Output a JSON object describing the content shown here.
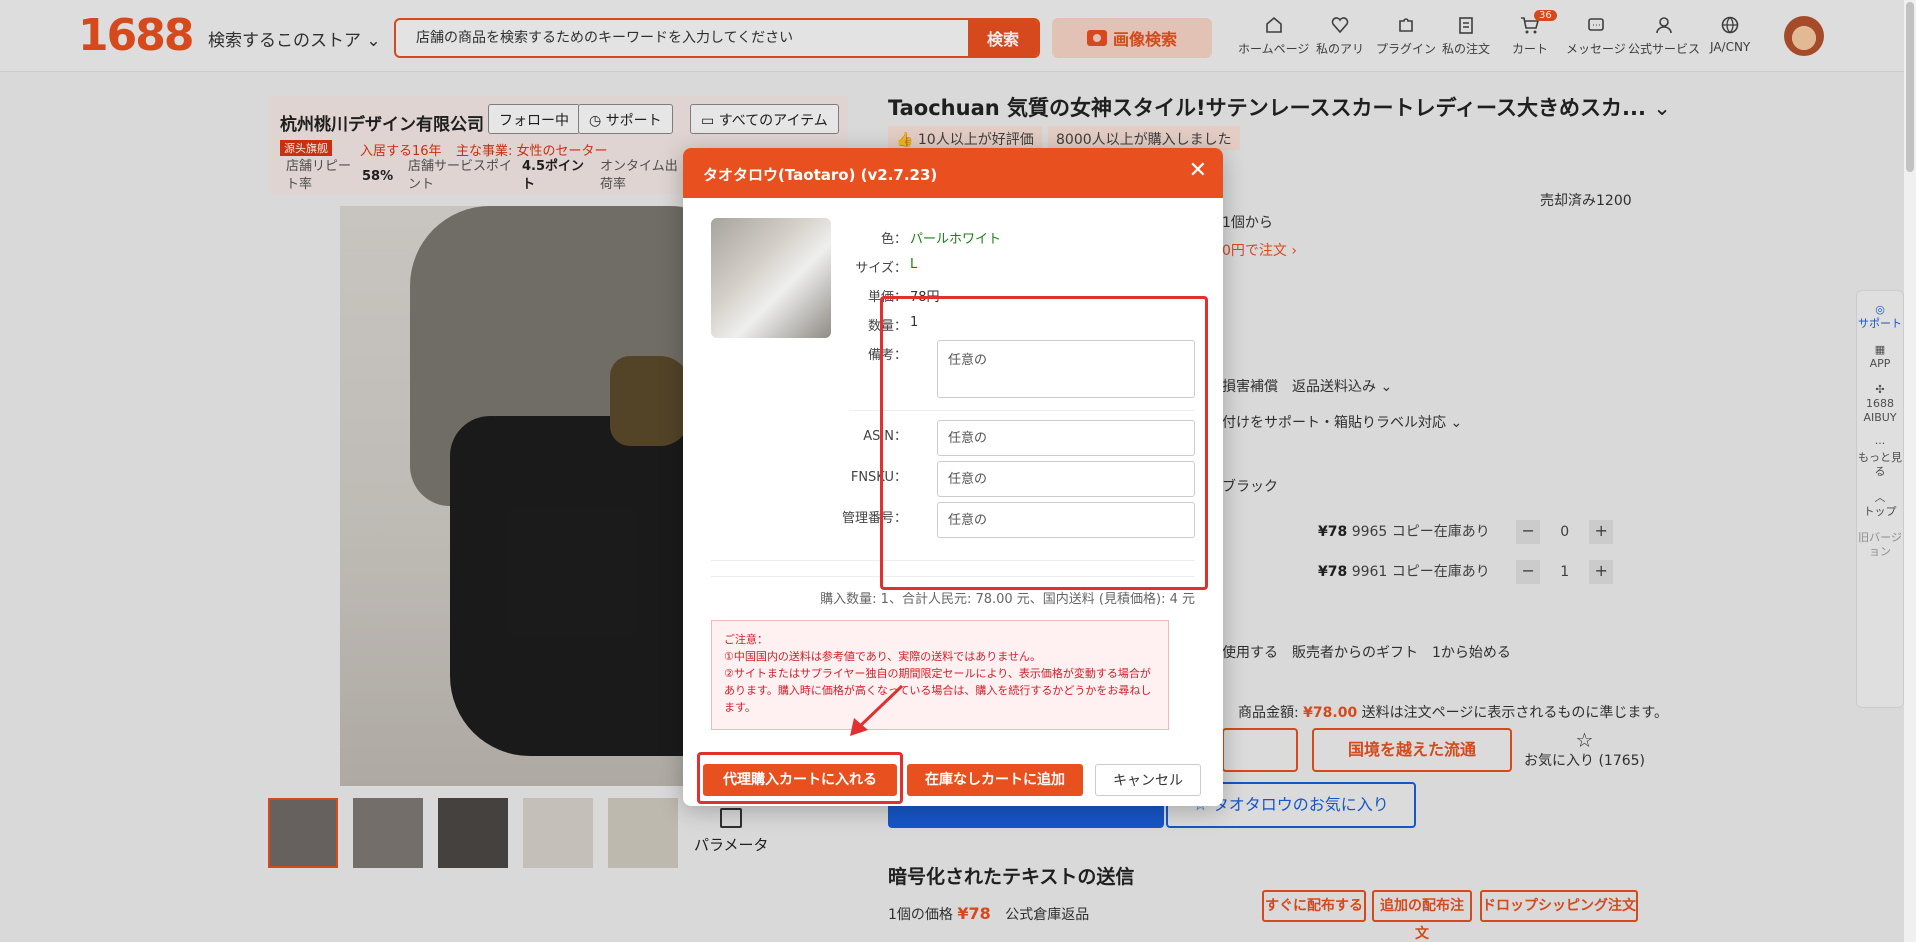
{
  "header": {
    "logo": "1688",
    "store_search_label": "検索するこのストア",
    "search_placeholder": "店舗の商品を検索するためのキーワードを入力してください",
    "search_button": "検索",
    "image_search": "画像検索",
    "nav": [
      {
        "label": "ホームページ",
        "icon": "home-icon"
      },
      {
        "label": "私のアリ",
        "icon": "heart-icon"
      },
      {
        "label": "プラグイン",
        "icon": "puzzle-icon"
      },
      {
        "label": "私の注文",
        "icon": "clipboard-icon"
      },
      {
        "label": "カート",
        "icon": "cart-icon",
        "badge": "36"
      },
      {
        "label": "メッセージ",
        "icon": "message-icon"
      },
      {
        "label": "公式サービス",
        "icon": "user-icon"
      },
      {
        "label": "JA/CNY",
        "icon": "globe-icon"
      }
    ]
  },
  "shop": {
    "name": "杭州桃川デザイン有限公司",
    "follow": "フォロー中",
    "support": "サポート",
    "all_items": "すべてのアイテム",
    "flagship": "源头旗舰",
    "years": "入居する16年",
    "business": "主な事業: 女性のセーター",
    "stats": [
      {
        "label": "店舗リピート率",
        "value": "58%"
      },
      {
        "label": "店舗サービスポイント",
        "value": "4.5ポイント"
      },
      {
        "label": "オンタイム出荷率",
        "value": ""
      }
    ]
  },
  "product": {
    "title": "Taochuan 気質の女神スタイル!サテンレーススカートレディース大きめスカ...",
    "badge_good": "10人以上が好評価",
    "badge_bought": "8000人以上が購入しました",
    "sold": "売却済み1200",
    "min_order": "1個から",
    "order_link": "0円で注文 ›",
    "services": "損害補償　返品送料込み ⌄",
    "labels": "付けをサポート・箱貼りラベル対応 ⌄",
    "color_option": "ブラック",
    "stock_rows": [
      {
        "price": "¥78",
        "stock": "9965 コピー在庫あり",
        "qty": "0"
      },
      {
        "price": "¥78",
        "stock": "9961 コピー在庫あり",
        "qty": "1"
      }
    ],
    "gift": "使用する　販売者からのギフト　1から始める",
    "amount_label": "商品金額:",
    "amount_value": "¥78.00",
    "amount_note": "送料は注文ページに表示されるものに準じます。",
    "cross_border": "国境を越えた流通",
    "favorite": "お気に入り (1765)",
    "taotaro_fav": "タオタロウのお気に入り",
    "param_label": "パラメータ",
    "send_title": "暗号化されたテキストの送信",
    "unit_price_label": "1個の価格",
    "unit_price": "¥78",
    "warehouse": "公式倉庫返品",
    "actions": [
      "すぐに配布する",
      "追加の配布注文",
      "ドロップシッピング注文"
    ]
  },
  "side_rail": [
    "サポート",
    "APP",
    "1688 AIBUY",
    "もっと見る",
    "トップ",
    "旧バージョン"
  ],
  "modal": {
    "title": "タオタロウ(Taotaro) (v2.7.23)",
    "fields": {
      "color_label": "色：",
      "color_value": "パールホワイト",
      "size_label": "サイズ：",
      "size_value": "L",
      "unit_label": "単価：",
      "unit_value": "78円",
      "qty_label": "数量：",
      "qty_value": "1",
      "note_label": "備考：",
      "note_placeholder": "任意の",
      "asin_label": "ASIN：",
      "asin_placeholder": "任意の",
      "fnsku_label": "FNSKU：",
      "fnsku_placeholder": "任意の",
      "mgmt_label": "管理番号：",
      "mgmt_placeholder": "任意の"
    },
    "summary": "購入数量: 1、合計人民元: 78.00 元、国内送料 (見積価格): 4 元",
    "notice_lines": [
      "ご注意：",
      "①中国国内の送料は参考値であり、実際の送料ではありません。",
      "②サイトまたはサプライヤー独自の期間限定セールにより、表示価格が変動する場合があります。購入時に価格が高くなっている場合は、購入を続行するかどうかをお尋ねします。"
    ],
    "btn_proxy_cart": "代理購入カートに入れる",
    "btn_nostock_cart": "在庫なしカートに追加",
    "btn_cancel": "キャンセル"
  },
  "colors": {
    "accent": "#e8501f",
    "annotation": "#e03030",
    "blue": "#1a5ed8"
  }
}
